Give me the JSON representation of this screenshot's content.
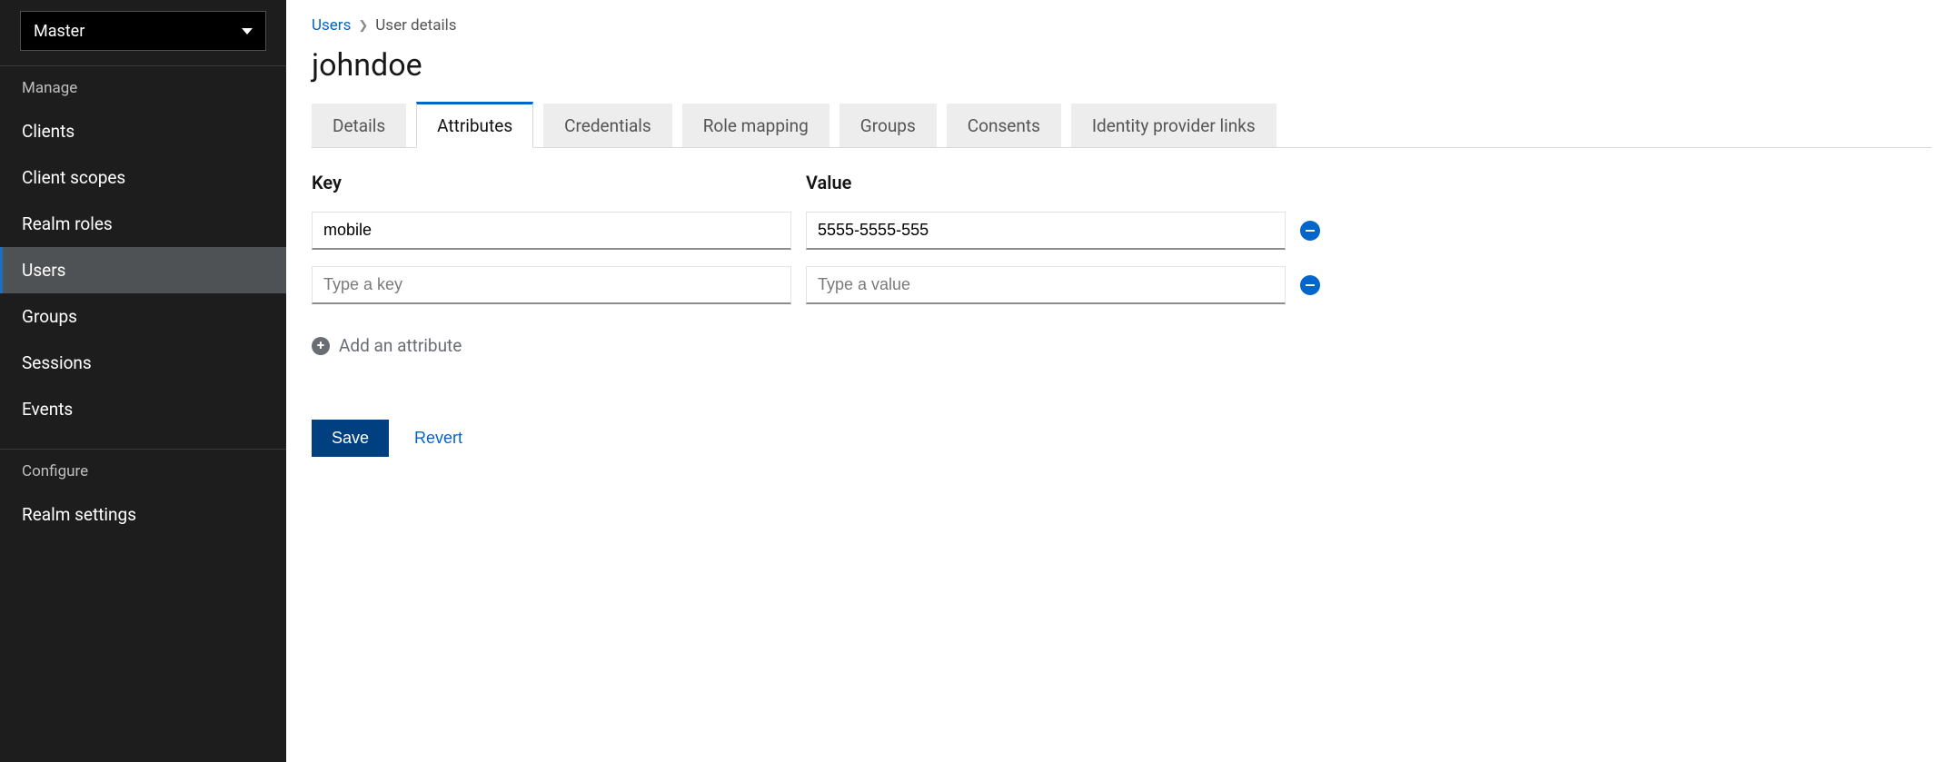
{
  "realm_selector": {
    "current": "Master"
  },
  "sidebar": {
    "sections": [
      {
        "header": "Manage",
        "items": [
          {
            "label": "Clients",
            "active": false
          },
          {
            "label": "Client scopes",
            "active": false
          },
          {
            "label": "Realm roles",
            "active": false
          },
          {
            "label": "Users",
            "active": true
          },
          {
            "label": "Groups",
            "active": false
          },
          {
            "label": "Sessions",
            "active": false
          },
          {
            "label": "Events",
            "active": false
          }
        ]
      },
      {
        "header": "Configure",
        "items": [
          {
            "label": "Realm settings",
            "active": false
          }
        ]
      }
    ]
  },
  "breadcrumb": {
    "root": "Users",
    "current": "User details"
  },
  "page_title": "johndoe",
  "tabs": [
    {
      "label": "Details",
      "active": false
    },
    {
      "label": "Attributes",
      "active": true
    },
    {
      "label": "Credentials",
      "active": false
    },
    {
      "label": "Role mapping",
      "active": false
    },
    {
      "label": "Groups",
      "active": false
    },
    {
      "label": "Consents",
      "active": false
    },
    {
      "label": "Identity provider links",
      "active": false
    }
  ],
  "attributes": {
    "columns": {
      "key": "Key",
      "value": "Value"
    },
    "rows": [
      {
        "key": "mobile",
        "value": "5555-5555-555"
      },
      {
        "key": "",
        "value": ""
      }
    ],
    "placeholders": {
      "key": "Type a key",
      "value": "Type a value"
    },
    "add_label": "Add an attribute"
  },
  "actions": {
    "save": "Save",
    "revert": "Revert"
  }
}
